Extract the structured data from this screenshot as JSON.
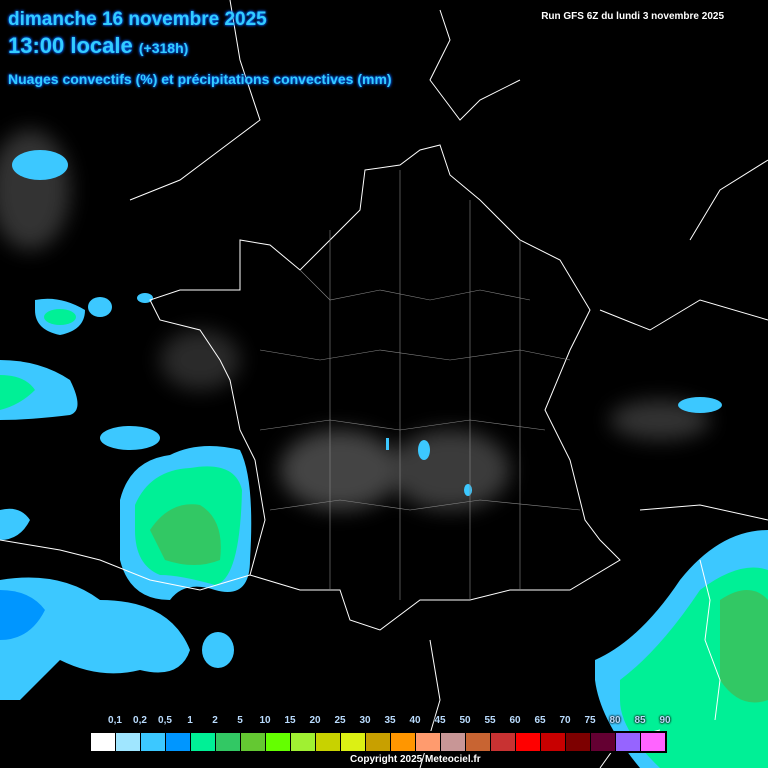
{
  "header": {
    "date": "dimanche 16 novembre 2025",
    "time": "13:00 locale",
    "offset": "(+318h)",
    "subtitle": "Nuages convectifs (%) et précipitations convectives (mm)",
    "run": "Run GFS 6Z du lundi 3 novembre 2025"
  },
  "legend": {
    "labels": [
      "0,1",
      "0,2",
      "0,5",
      "1",
      "2",
      "5",
      "10",
      "15",
      "20",
      "25",
      "30",
      "35",
      "40",
      "45",
      "50",
      "55",
      "60",
      "65",
      "70",
      "75",
      "80",
      "85",
      "90"
    ],
    "colors": [
      "#ffffff",
      "#a0e6ff",
      "#3cc8ff",
      "#0096ff",
      "#00f096",
      "#32c864",
      "#64c832",
      "#64ff00",
      "#a0f032",
      "#c8d200",
      "#dcf014",
      "#c8a000",
      "#ff9600",
      "#ff9b6e",
      "#c89696",
      "#c86432",
      "#c83232",
      "#ff0000",
      "#c80000",
      "#7d0000",
      "#640032",
      "#9664ff",
      "#ff64ff"
    ]
  },
  "footer": {
    "copyright": "Copyright 2025 Meteociel.fr"
  }
}
